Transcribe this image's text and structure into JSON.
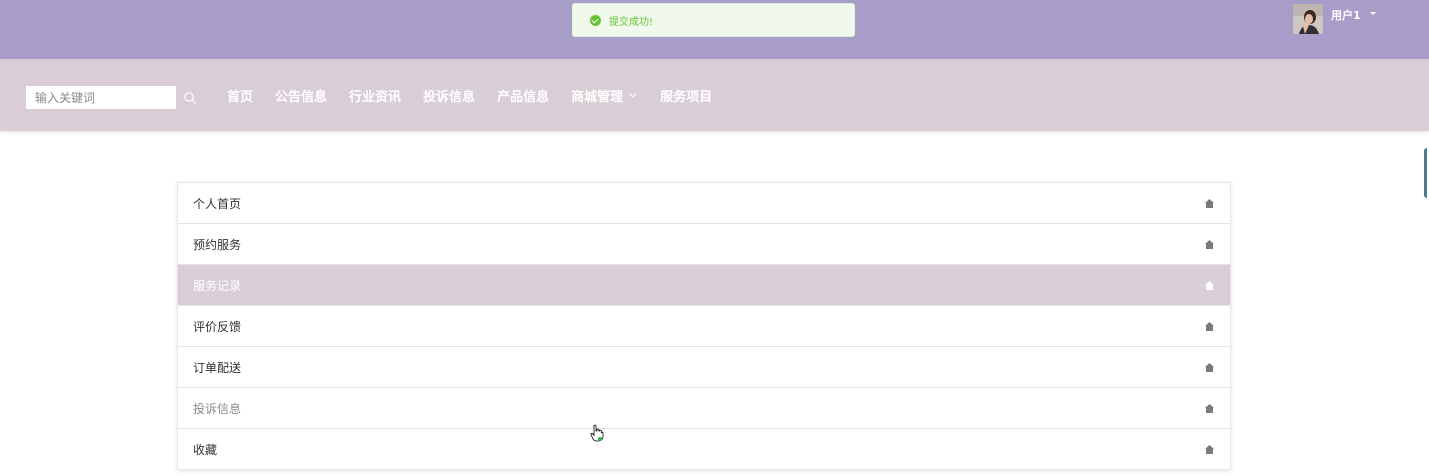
{
  "toast": {
    "message": "提交成功!",
    "type": "success",
    "color": "#67c23a"
  },
  "user": {
    "name": "用户1",
    "avatar": "user-avatar-photo"
  },
  "search": {
    "placeholder": "输入关键词",
    "value": "",
    "icon": "search-icon"
  },
  "nav": {
    "items": [
      {
        "label": "首页"
      },
      {
        "label": "公告信息"
      },
      {
        "label": "行业资讯"
      },
      {
        "label": "投诉信息"
      },
      {
        "label": "产品信息"
      },
      {
        "label": "商城管理",
        "has_dropdown": true
      },
      {
        "label": "服务项目"
      }
    ]
  },
  "menu": {
    "active_index": 2,
    "items": [
      {
        "label": "个人首页",
        "icon": "home-icon"
      },
      {
        "label": "预约服务",
        "icon": "home-icon"
      },
      {
        "label": "服务记录",
        "icon": "home-icon",
        "active": true
      },
      {
        "label": "评价反馈",
        "icon": "home-icon"
      },
      {
        "label": "订单配送",
        "icon": "home-icon"
      },
      {
        "label": "投诉信息",
        "icon": "home-icon",
        "hovered": true
      },
      {
        "label": "收藏",
        "icon": "home-icon"
      }
    ]
  },
  "colors": {
    "topbar": "#a89dc8",
    "navbar": "#d9cdd6",
    "active_item": "#d9cdd6",
    "success": "#67c23a"
  }
}
